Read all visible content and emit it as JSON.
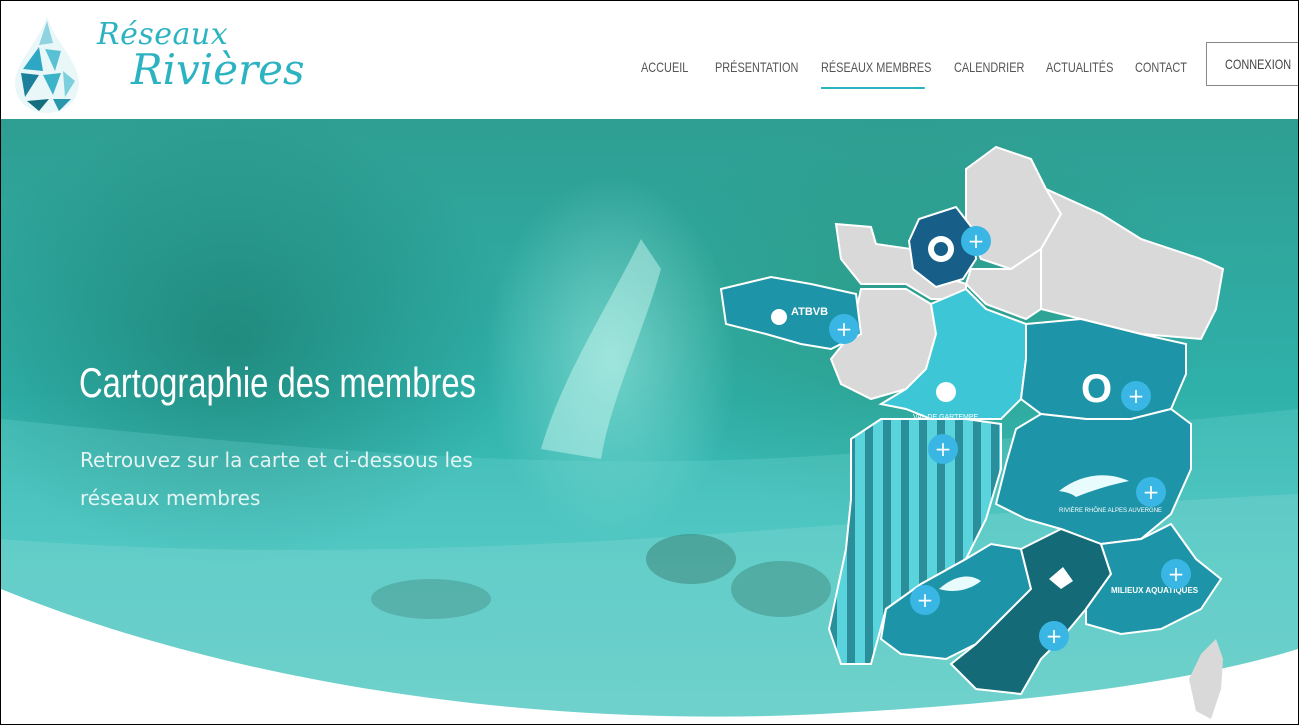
{
  "brand": {
    "line1": "Réseaux",
    "line2": "Rivières"
  },
  "nav": {
    "items": [
      {
        "label": "ACCUEIL"
      },
      {
        "label": "PRÉSENTATION"
      },
      {
        "label": "RÉSEAUX MEMBRES",
        "active": true
      },
      {
        "label": "CALENDRIER"
      },
      {
        "label": "ACTUALITÉS"
      },
      {
        "label": "CONTACT"
      }
    ],
    "login": "CONNEXION"
  },
  "hero": {
    "title": "Cartographie des membres",
    "subtitle": "Retrouvez sur la carte et ci-dessous les réseaux membres"
  },
  "map": {
    "logos": {
      "atbvb": "ATBVB",
      "val": "VAL DE GARTEMPE",
      "o": "O",
      "rhone": "RIVIÈRE RHÔNE ALPES AUVERGNE",
      "milieux": "MILIEUX AQUATIQUES"
    },
    "colors": {
      "grey": "#d9d9d9",
      "navy": "#175f88",
      "light": "#3cc6d6",
      "teal": "#1e94a8",
      "dark": "#156a77",
      "stripe": "#2a8f9a",
      "plus": "#3ab6e4"
    },
    "plus_symbol": "+"
  }
}
